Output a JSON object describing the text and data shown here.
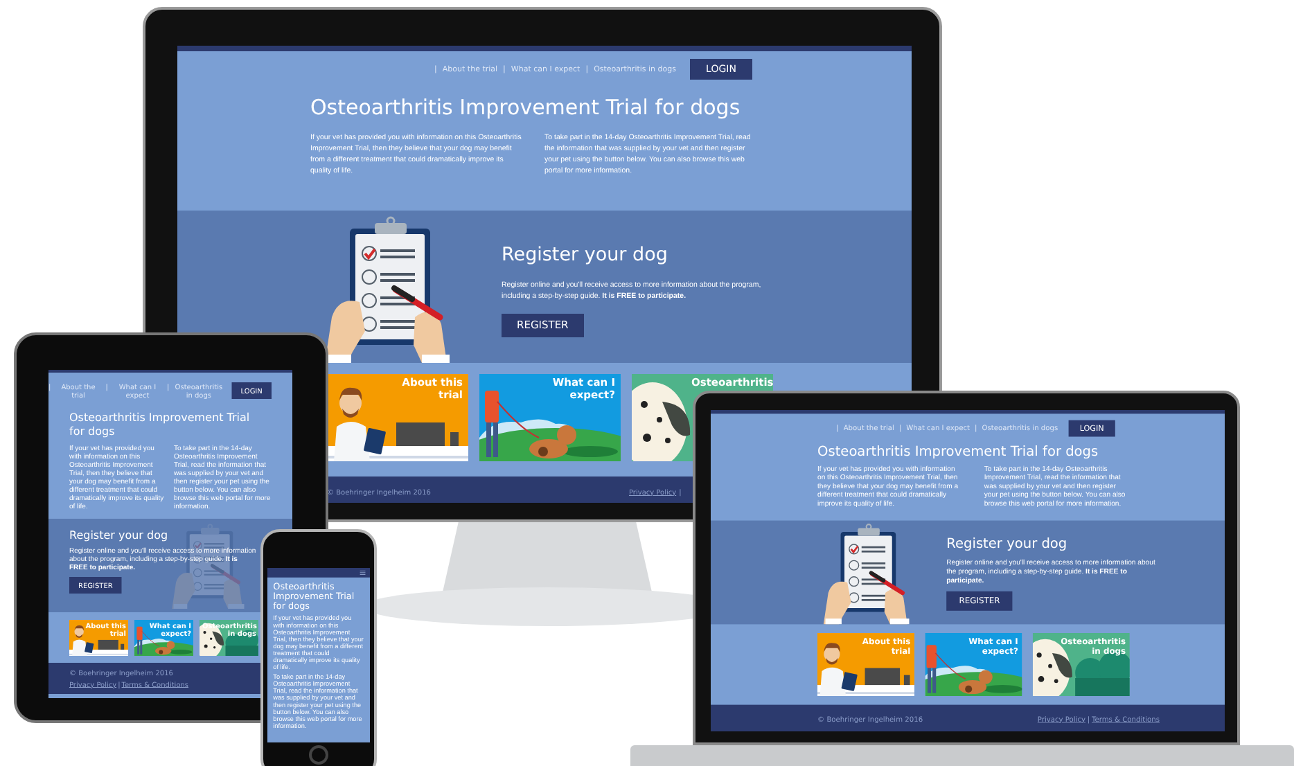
{
  "devices": [
    {
      "kind": "desktop",
      "site": {
        "nav": [
          {
            "kind": "separator",
            "label": "|"
          },
          {
            "kind": "link",
            "label": "About the trial"
          },
          {
            "kind": "separator",
            "label": "|"
          },
          {
            "kind": "link",
            "label": "What can I expect"
          },
          {
            "kind": "separator",
            "label": "|"
          },
          {
            "kind": "link",
            "label": "Osteoarthritis in dogs"
          }
        ],
        "login": "LOGIN",
        "title": "Osteoarthritis Improvement Trial for dogs",
        "intro": [
          "If your vet has provided you with information on this Osteoarthritis Improvement Trial, then they believe that your dog may benefit from a different treatment that could dramatically improve its quality of life.",
          "To take part in the 14-day Osteoarthritis Improvement Trial, read the information that was supplied by your vet and then register your pet using the button below. You can also browse this web portal for more information."
        ],
        "register": {
          "heading": "Register your dog",
          "text": "Register online and you'll receive access to more information about the program, including a step-by-step guide. **It is FREE to participate.**",
          "button": "REGISTER"
        },
        "cards": [
          {
            "kind": "vet",
            "title": "About this trial"
          },
          {
            "kind": "walk",
            "title": "What can I expect?"
          },
          {
            "kind": "dalmatian",
            "title": "Osteoarthritis"
          }
        ],
        "footer": {
          "copyright": "© Boehringer Ingelheim 2016",
          "links": [
            {
              "kind": "link",
              "label": "Privacy Policy"
            },
            {
              "kind": "separator",
              "label": "|"
            }
          ]
        }
      }
    },
    {
      "kind": "tablet",
      "site": {
        "nav": [
          {
            "kind": "separator",
            "label": "|"
          },
          {
            "kind": "link",
            "label": "About the trial"
          },
          {
            "kind": "separator",
            "label": "|"
          },
          {
            "kind": "link",
            "label": "What can I expect"
          },
          {
            "kind": "separator",
            "label": "|"
          },
          {
            "kind": "link",
            "label": "Osteoarthritis in dogs"
          }
        ],
        "login": "LOGIN",
        "title": "Osteoarthritis Improvement Trial for dogs",
        "intro": [
          "If your vet has provided you with information on this Osteoarthritis Improvement Trial, then they believe that your dog may benefit from a different treatment that could dramatically improve its quality of life.",
          "To take part in the 14-day Osteoarthritis Improvement Trial, read the information that was supplied by your vet and then register your pet using the button below. You can also browse this web portal for more information."
        ],
        "register": {
          "heading": "Register your dog",
          "text": "Register online and you'll receive access to more information about the program, including a step-by-step guide. **It is FREE to participate.**",
          "button": "REGISTER"
        },
        "cards": [
          {
            "kind": "vet",
            "title": "About this trial"
          },
          {
            "kind": "walk",
            "title": "What can I expect?"
          },
          {
            "kind": "dalmatian",
            "title": "Osteoarthritis in dogs"
          }
        ],
        "footer": {
          "copyright": "© Boehringer Ingelheim 2016",
          "links": [
            {
              "kind": "link",
              "label": "Privacy Policy"
            },
            {
              "kind": "separator",
              "label": "|"
            },
            {
              "kind": "link",
              "label": "Terms & Conditions"
            }
          ]
        }
      }
    },
    {
      "kind": "phone",
      "site": {
        "menu": true,
        "title": "Osteoarthritis Improvement Trial for dogs",
        "intro": [
          "If your vet has provided you with information on this Osteoarthritis Improvement Trial, then they believe that your dog may benefit from a different treatment that could dramatically improve its quality of life.",
          "To take part in the 14-day Osteoarthritis Improvement Trial, read the information that was supplied by your vet and then register your pet using the button below. You can also browse this web portal for more information."
        ]
      }
    },
    {
      "kind": "laptop",
      "site": {
        "nav": [
          {
            "kind": "separator",
            "label": "|"
          },
          {
            "kind": "link",
            "label": "About the trial"
          },
          {
            "kind": "separator",
            "label": "|"
          },
          {
            "kind": "link",
            "label": "What can I expect"
          },
          {
            "kind": "separator",
            "label": "|"
          },
          {
            "kind": "link",
            "label": "Osteoarthritis in dogs"
          }
        ],
        "login": "LOGIN",
        "title": "Osteoarthritis Improvement Trial for dogs",
        "intro": [
          "If your vet has provided you with information on this Osteoarthritis Improvement Trial, then they believe that your dog may benefit from a different treatment that could dramatically improve its quality of life.",
          "To take part in the 14-day Osteoarthritis Improvement Trial, read the information that was supplied by your vet and then register your pet using the button below. You can also browse this web portal for more information."
        ],
        "register": {
          "heading": "Register your dog",
          "text": "Register online and you'll receive access to more information about the program, including a step-by-step guide. **It is FREE to participate.**",
          "button": "REGISTER"
        },
        "cards": [
          {
            "kind": "vet",
            "title": "About this trial"
          },
          {
            "kind": "walk",
            "title": "What can I expect?"
          },
          {
            "kind": "dalmatian",
            "title": "Osteoarthritis in dogs"
          }
        ],
        "footer": {
          "copyright": "© Boehringer Ingelheim 2016",
          "links": [
            {
              "kind": "link",
              "label": "Privacy Policy"
            },
            {
              "kind": "separator",
              "label": "|"
            },
            {
              "kind": "link",
              "label": "Terms & Conditions"
            }
          ]
        }
      }
    }
  ]
}
